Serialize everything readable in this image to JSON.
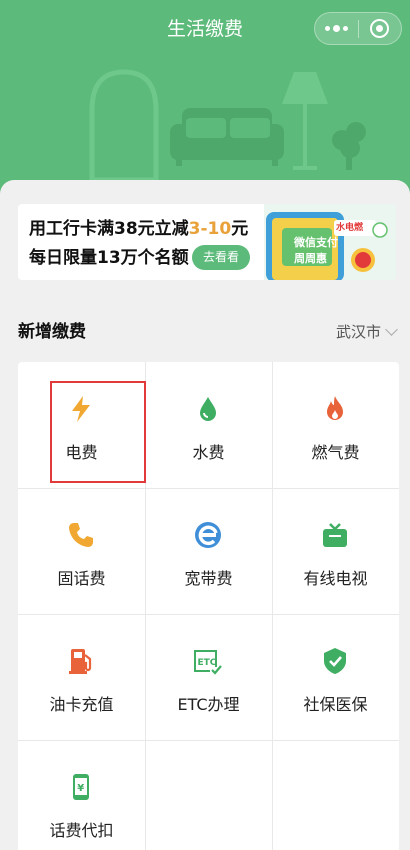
{
  "header": {
    "title": "生活缴费"
  },
  "capsule": {
    "more_icon": "more-dots-icon",
    "close_icon": "target-close-icon"
  },
  "banner": {
    "line1_prefix": "用工行卡满",
    "line1_amount": "38",
    "line1_mid": "元立减",
    "line1_highlight": "3-10",
    "line1_suffix": "元",
    "line2": "每日限量13万个名额",
    "button": "去看看",
    "art_line1": "微信支付",
    "art_line2": "周周惠",
    "art_badge": "水电燃"
  },
  "section": {
    "title": "新增缴费",
    "city": "武汉市"
  },
  "services": [
    {
      "label": "电费",
      "icon": "lightning-icon",
      "selected": true
    },
    {
      "label": "水费",
      "icon": "water-drop-icon"
    },
    {
      "label": "燃气费",
      "icon": "flame-icon"
    },
    {
      "label": "固话费",
      "icon": "phone-icon"
    },
    {
      "label": "宽带费",
      "icon": "broadband-e-icon"
    },
    {
      "label": "有线电视",
      "icon": "tv-icon"
    },
    {
      "label": "油卡充值",
      "icon": "fuel-pump-icon"
    },
    {
      "label": "ETC办理",
      "icon": "etc-icon"
    },
    {
      "label": "社保医保",
      "icon": "shield-check-icon"
    },
    {
      "label": "话费代扣",
      "icon": "mobile-yuan-icon"
    }
  ],
  "colors": {
    "brand": "#5cba7a",
    "accent": "#e9a23a",
    "selection": "#e23a3a"
  }
}
